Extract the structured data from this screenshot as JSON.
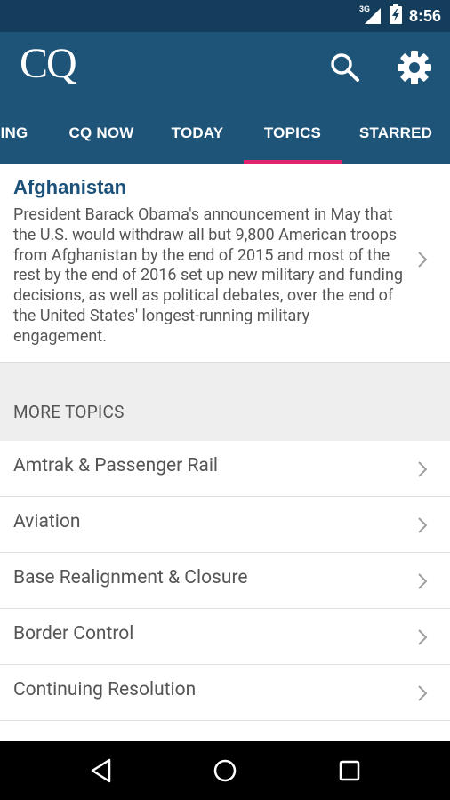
{
  "status_bar": {
    "network_type": "3G",
    "time": "8:56"
  },
  "app_bar": {
    "logo_text": "CQ"
  },
  "tabs": [
    {
      "label": "ING"
    },
    {
      "label": "CQ NOW"
    },
    {
      "label": "TODAY"
    },
    {
      "label": "TOPICS"
    },
    {
      "label": "STARRED"
    }
  ],
  "featured": {
    "title": "Afghanistan",
    "description": "President Barack Obama's announcement in May that the U.S. would withdraw all but 9,800 American troops from Afghanistan by the end of 2015 and most of the rest by the end of 2016 set up new military and funding decisions, as well as political debates, over the end of the United States' longest-running military engagement."
  },
  "more_topics": {
    "header": "MORE TOPICS",
    "items": [
      {
        "label": "Amtrak & Passenger Rail"
      },
      {
        "label": "Aviation"
      },
      {
        "label": "Base Realignment & Closure"
      },
      {
        "label": "Border Control"
      },
      {
        "label": "Continuing Resolution"
      },
      {
        "label": ""
      }
    ]
  },
  "colors": {
    "app_bar": "#1f5479",
    "status_bar": "#143d5b",
    "tab_indicator": "#e2246f",
    "title_accent": "#1c5179"
  }
}
